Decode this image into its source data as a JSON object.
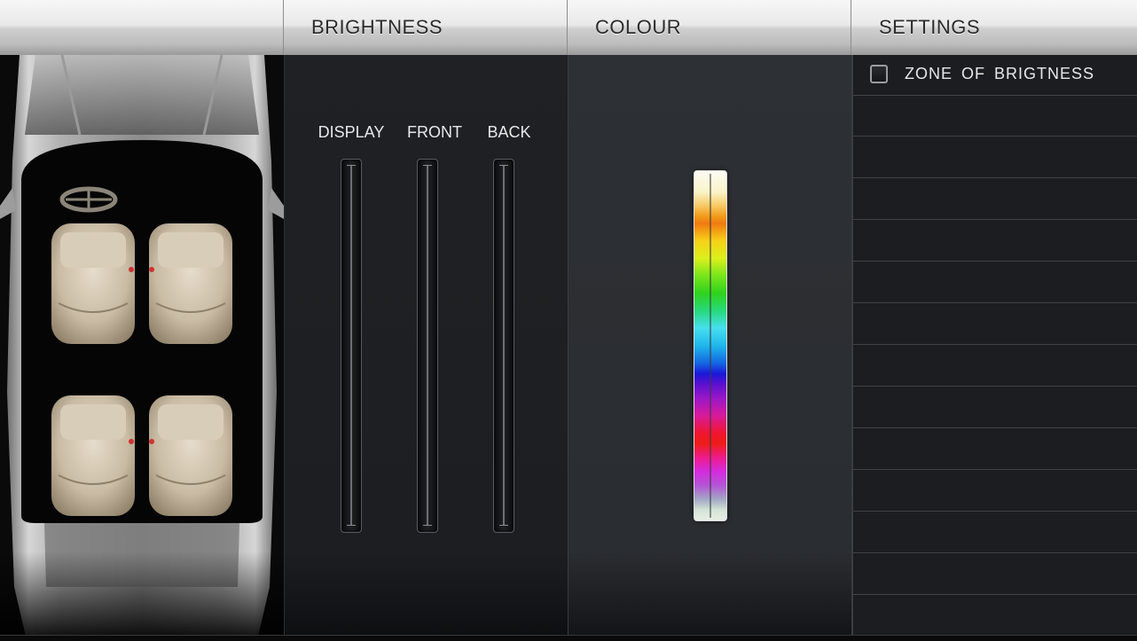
{
  "header": {
    "tabs": [
      {
        "label": ""
      },
      {
        "label": "BRIGHTNESS"
      },
      {
        "label": "COLOUR"
      },
      {
        "label": "SETTINGS"
      }
    ]
  },
  "brightness": {
    "sliders": [
      {
        "label": "DISPLAY"
      },
      {
        "label": "FRONT"
      },
      {
        "label": "BACK"
      }
    ]
  },
  "colour": {
    "spectrum": "rainbow"
  },
  "settings": {
    "items": [
      {
        "label": "ZONE  OF  BRIGTNESS",
        "checked": false
      }
    ]
  },
  "colors": {
    "header": "#d8d8d8",
    "panel_dark": "#1c1e21",
    "panel_mid": "#2a2d31",
    "text": "#e8e8e8"
  }
}
